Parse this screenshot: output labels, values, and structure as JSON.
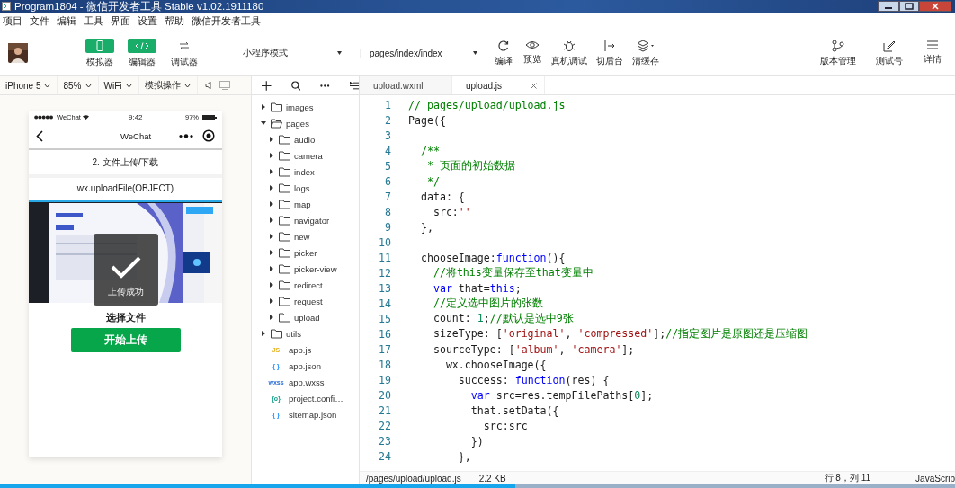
{
  "window": {
    "title": "Program1804 - 微信开发者工具 Stable v1.02.1911180"
  },
  "menu": [
    "项目",
    "文件",
    "编辑",
    "工具",
    "界面",
    "设置",
    "帮助",
    "微信开发者工具"
  ],
  "toolbar": {
    "view_buttons": [
      {
        "label": "模拟器",
        "kind": "phone",
        "selected": true
      },
      {
        "label": "编辑器",
        "kind": "code",
        "selected": true
      },
      {
        "label": "调试器",
        "kind": "debug",
        "selected": false
      }
    ],
    "mode": "小程序模式",
    "page": "pages/index/index",
    "tools": [
      {
        "label": "编译",
        "kind": "refresh"
      },
      {
        "label": "预览",
        "kind": "eye"
      },
      {
        "label": "真机调试",
        "kind": "bug"
      },
      {
        "label": "切后台",
        "kind": "switch"
      },
      {
        "label": "清缓存",
        "kind": "layers"
      }
    ],
    "right_tools": [
      {
        "label": "版本管理",
        "kind": "branch"
      },
      {
        "label": "测试号",
        "kind": "edit"
      },
      {
        "label": "详情",
        "kind": "menu"
      }
    ]
  },
  "simulator_bar": {
    "dropdowns": [
      "iPhone 5",
      "85%",
      "WiFi",
      "模拟操作"
    ]
  },
  "phone": {
    "carrier": "WeChat",
    "time": "9:42",
    "battery": "97%",
    "nav_title": "WeChat",
    "heading": "2. 文件上传/下载",
    "api": "wx.uploadFile(OBJECT)",
    "toast": "上传成功",
    "choose_label": "选择文件",
    "upload_button": "开始上传"
  },
  "file_tree": [
    {
      "name": "images",
      "kind": "folder",
      "expanded": false
    },
    {
      "name": "pages",
      "kind": "folder",
      "expanded": true,
      "children": [
        {
          "name": "audio",
          "kind": "folder",
          "expanded": false
        },
        {
          "name": "camera",
          "kind": "folder",
          "expanded": false
        },
        {
          "name": "index",
          "kind": "folder",
          "expanded": false
        },
        {
          "name": "logs",
          "kind": "folder",
          "expanded": false
        },
        {
          "name": "map",
          "kind": "folder",
          "expanded": false
        },
        {
          "name": "navigator",
          "kind": "folder",
          "expanded": false
        },
        {
          "name": "new",
          "kind": "folder",
          "expanded": false
        },
        {
          "name": "picker",
          "kind": "folder",
          "expanded": false
        },
        {
          "name": "picker-view",
          "kind": "folder",
          "expanded": false
        },
        {
          "name": "redirect",
          "kind": "folder",
          "expanded": false
        },
        {
          "name": "request",
          "kind": "folder",
          "expanded": false
        },
        {
          "name": "upload",
          "kind": "folder",
          "expanded": false
        }
      ]
    },
    {
      "name": "utils",
      "kind": "folder",
      "expanded": false
    },
    {
      "name": "app.js",
      "kind": "js",
      "badge": "JS"
    },
    {
      "name": "app.json",
      "kind": "json",
      "badge": "{ }"
    },
    {
      "name": "app.wxss",
      "kind": "wxss",
      "badge": "wxss"
    },
    {
      "name": "project.confi…",
      "kind": "config",
      "badge": "{o}"
    },
    {
      "name": "sitemap.json",
      "kind": "json",
      "badge": "{ }"
    }
  ],
  "editor": {
    "tabs": [
      {
        "label": "upload.wxml",
        "selected": false
      },
      {
        "label": "upload.js",
        "selected": true
      }
    ],
    "lines": [
      {
        "number": "1",
        "tokens": [
          {
            "t": "// pages/upload/upload.js",
            "kind": "comment"
          }
        ]
      },
      {
        "number": "2",
        "tokens": [
          {
            "t": "Page({",
            "kind": "plain"
          }
        ]
      },
      {
        "number": "3"
      },
      {
        "number": "4",
        "tokens": [
          {
            "t": "  /**",
            "kind": "comment"
          }
        ]
      },
      {
        "number": "5",
        "tokens": [
          {
            "t": "   * 页面的初始数据",
            "kind": "comment"
          }
        ]
      },
      {
        "number": "6",
        "tokens": [
          {
            "t": "   */",
            "kind": "comment"
          }
        ]
      },
      {
        "number": "7",
        "tokens": [
          {
            "t": "  data: {",
            "kind": "plain"
          }
        ]
      },
      {
        "number": "8",
        "tokens": [
          {
            "t": "    src:",
            "kind": "plain"
          },
          {
            "t": "''",
            "kind": "string"
          }
        ]
      },
      {
        "number": "9",
        "tokens": [
          {
            "t": "  },",
            "kind": "plain"
          }
        ]
      },
      {
        "number": "10"
      },
      {
        "number": "11",
        "tokens": [
          {
            "t": "  chooseImage:",
            "kind": "plain"
          },
          {
            "t": "function",
            "kind": "keyword"
          },
          {
            "t": "(){",
            "kind": "plain"
          }
        ]
      },
      {
        "number": "12",
        "tokens": [
          {
            "t": "    //将this变量保存至that变量中",
            "kind": "comment"
          }
        ]
      },
      {
        "number": "13",
        "tokens": [
          {
            "t": "    var",
            "kind": "keyword"
          },
          {
            "t": " that=",
            "kind": "plain"
          },
          {
            "t": "this",
            "kind": "keyword"
          },
          {
            "t": ";",
            "kind": "plain"
          }
        ]
      },
      {
        "number": "14",
        "tokens": [
          {
            "t": "    //定义选中图片的张数",
            "kind": "comment"
          }
        ]
      },
      {
        "number": "15",
        "tokens": [
          {
            "t": "    count: ",
            "kind": "plain"
          },
          {
            "t": "1",
            "kind": "number"
          },
          {
            "t": ";",
            "kind": "plain"
          },
          {
            "t": "//默认是选中9张",
            "kind": "comment"
          }
        ]
      },
      {
        "number": "16",
        "tokens": [
          {
            "t": "    sizeType: [",
            "kind": "plain"
          },
          {
            "t": "'original'",
            "kind": "string"
          },
          {
            "t": ", ",
            "kind": "plain"
          },
          {
            "t": "'compressed'",
            "kind": "string"
          },
          {
            "t": "];",
            "kind": "plain"
          },
          {
            "t": "//指定图片是原图还是压缩图",
            "kind": "comment"
          }
        ]
      },
      {
        "number": "17",
        "tokens": [
          {
            "t": "    sourceType: [",
            "kind": "plain"
          },
          {
            "t": "'album'",
            "kind": "string"
          },
          {
            "t": ", ",
            "kind": "plain"
          },
          {
            "t": "'camera'",
            "kind": "string"
          },
          {
            "t": "];",
            "kind": "plain"
          }
        ]
      },
      {
        "number": "18",
        "tokens": [
          {
            "t": "      wx.chooseImage({",
            "kind": "plain"
          }
        ]
      },
      {
        "number": "19",
        "tokens": [
          {
            "t": "        success: ",
            "kind": "plain"
          },
          {
            "t": "function",
            "kind": "keyword"
          },
          {
            "t": "(res) {",
            "kind": "plain"
          }
        ]
      },
      {
        "number": "20",
        "tokens": [
          {
            "t": "          var",
            "kind": "keyword"
          },
          {
            "t": " src=res.tempFilePaths[",
            "kind": "plain"
          },
          {
            "t": "0",
            "kind": "number"
          },
          {
            "t": "];",
            "kind": "plain"
          }
        ]
      },
      {
        "number": "21",
        "tokens": [
          {
            "t": "          that.setData({",
            "kind": "plain"
          }
        ]
      },
      {
        "number": "22",
        "tokens": [
          {
            "t": "            src:src",
            "kind": "plain"
          }
        ]
      },
      {
        "number": "23",
        "tokens": [
          {
            "t": "          })",
            "kind": "plain"
          }
        ]
      },
      {
        "number": "24",
        "tokens": [
          {
            "t": "        },",
            "kind": "plain"
          }
        ]
      }
    ]
  },
  "status_bar": {
    "path": "/pages/upload/upload.js",
    "size": "2.2 KB",
    "position": "行 8，列 11",
    "language": "JavaScrip"
  },
  "video_progress": {
    "level": 0.54
  }
}
